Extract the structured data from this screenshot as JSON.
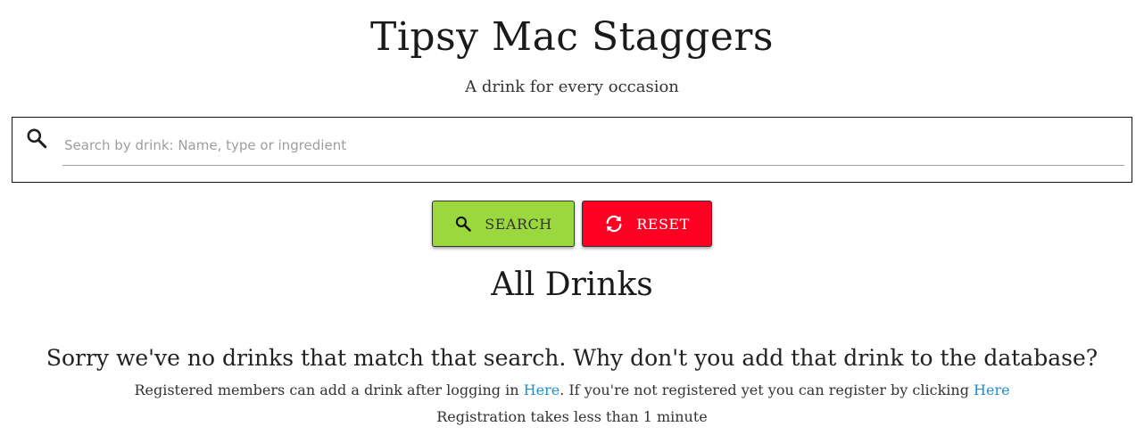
{
  "header": {
    "title": "Tipsy Mac Staggers",
    "subtitle": "A drink for every occasion"
  },
  "search": {
    "icon": "search-icon",
    "placeholder": "Search by drink: Name, type or ingredient",
    "value": ""
  },
  "buttons": {
    "search_label": "SEARCH",
    "search_icon": "search-icon",
    "search_color": "#9bd83d",
    "reset_label": "RESET",
    "reset_icon": "refresh-icon",
    "reset_color": "#ff0022"
  },
  "main": {
    "section_title": "All Drinks",
    "empty_message": "Sorry we've no drinks that match that search. Why don't you add that drink to the database?",
    "register_text_1": "Registered members can add a drink after logging in ",
    "login_link": "Here",
    "register_text_2": ". If you're not registered yet you can register by clicking ",
    "register_link": "Here",
    "registration_time": "Registration takes less than 1 minute",
    "link_color": "#1a8fd6"
  }
}
